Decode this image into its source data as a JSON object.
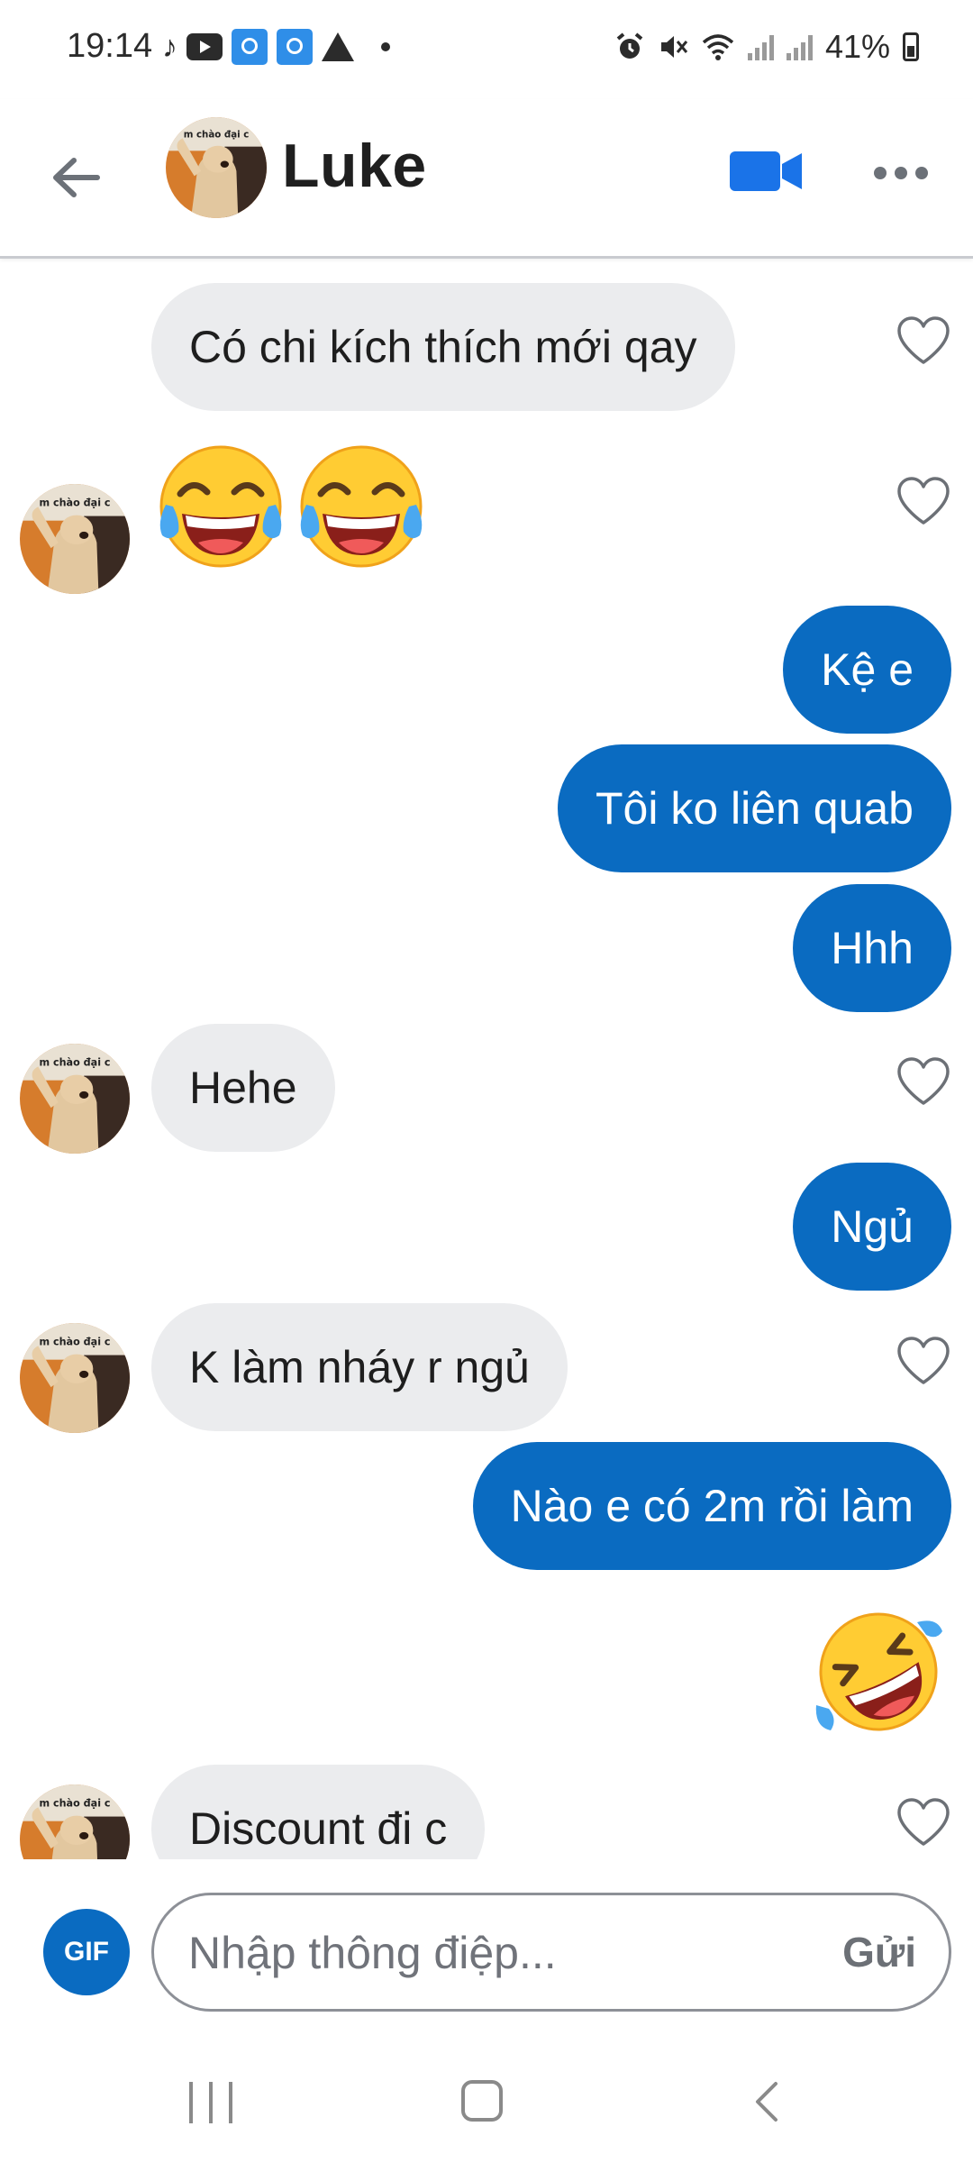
{
  "status_bar": {
    "time": "19:14",
    "battery_percent": "41%",
    "icons": [
      "tiktok-icon",
      "youtube-icon",
      "notification-icon",
      "notification-icon",
      "warning-icon",
      "dot-icon",
      "alarm-icon",
      "mute-icon",
      "wifi-icon",
      "signal-icon",
      "signal-icon",
      "battery-icon"
    ]
  },
  "header": {
    "contact_name": "Luke",
    "avatar_caption": "m chào đại c",
    "back_icon": "arrow-left-icon",
    "video_icon": "video-call-icon",
    "more_icon": "more-dots-icon",
    "accent_color": "#0a6bc1"
  },
  "messages": [
    {
      "side": "in",
      "text": "Có chi kích thích mới qay",
      "avatar": false
    },
    {
      "side": "in",
      "emoji": "face-with-tears-of-joy",
      "count": 2,
      "avatar": true
    },
    {
      "side": "out",
      "text": "Kệ e"
    },
    {
      "side": "out",
      "text": "Tôi ko liên quab"
    },
    {
      "side": "out",
      "text": "Hhh"
    },
    {
      "side": "in",
      "text": "Hehe",
      "avatar": true
    },
    {
      "side": "out",
      "text": "Ngủ"
    },
    {
      "side": "in",
      "text": "K làm nháy r ngủ",
      "avatar": true
    },
    {
      "side": "out",
      "text": "Nào e có 2m rồi làm"
    },
    {
      "side": "out",
      "emoji": "rolling-on-the-floor-laughing"
    },
    {
      "side": "in",
      "text": "Discount đi c",
      "avatar": true
    }
  ],
  "composer": {
    "gif_label": "GIF",
    "placeholder": "Nhập thông điệp...",
    "send_label": "Gửi"
  },
  "nav_bar": {
    "icons": [
      "recent-apps-icon",
      "home-icon",
      "back-icon"
    ]
  }
}
